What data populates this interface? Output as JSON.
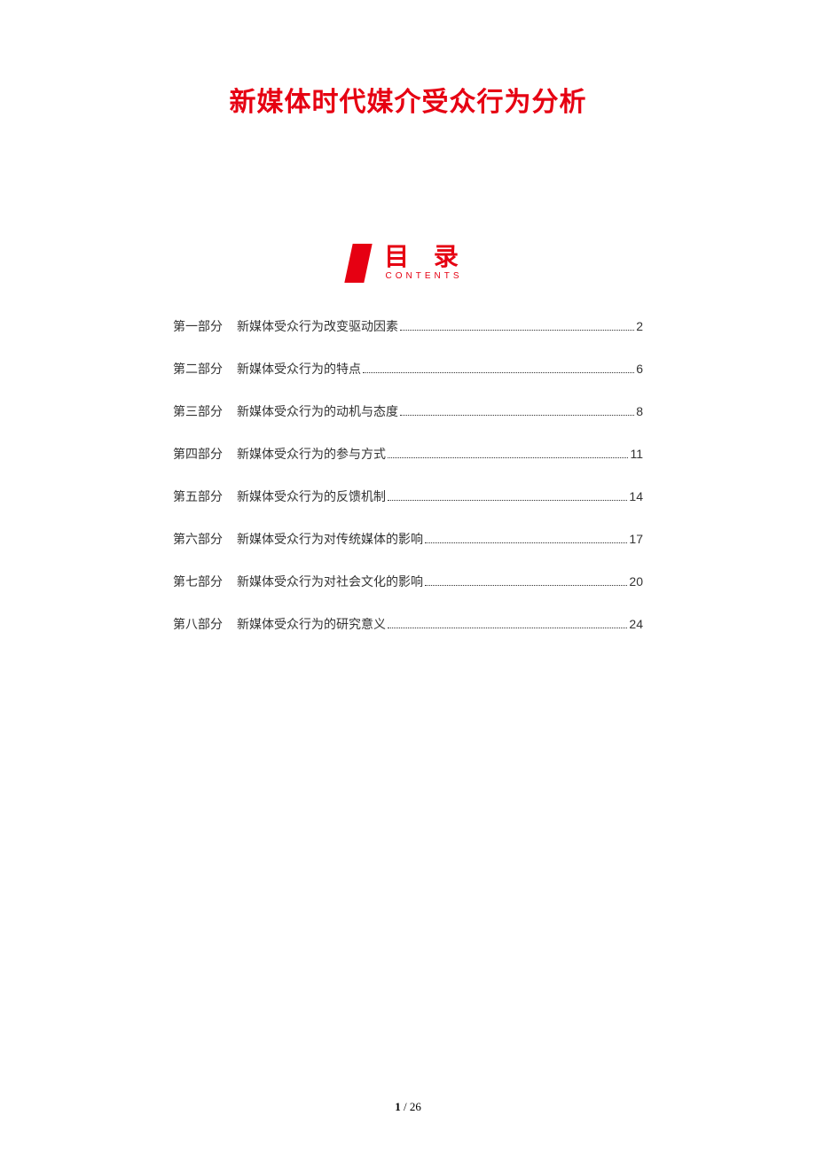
{
  "title": "新媒体时代媒介受众行为分析",
  "toc_header": {
    "label": "目 录",
    "sublabel": "CONTENTS"
  },
  "toc": [
    {
      "part": "第一部分",
      "title": "新媒体受众行为改变驱动因素",
      "page": "2"
    },
    {
      "part": "第二部分",
      "title": "新媒体受众行为的特点",
      "page": "6"
    },
    {
      "part": "第三部分",
      "title": "新媒体受众行为的动机与态度",
      "page": "8"
    },
    {
      "part": "第四部分",
      "title": "新媒体受众行为的参与方式",
      "page": "11"
    },
    {
      "part": "第五部分",
      "title": "新媒体受众行为的反馈机制",
      "page": "14"
    },
    {
      "part": "第六部分",
      "title": "新媒体受众行为对传统媒体的影响",
      "page": "17"
    },
    {
      "part": "第七部分",
      "title": "新媒体受众行为对社会文化的影响",
      "page": "20"
    },
    {
      "part": "第八部分",
      "title": "新媒体受众行为的研究意义",
      "page": "24"
    }
  ],
  "footer": {
    "current": "1",
    "sep": " / ",
    "total": "26"
  }
}
